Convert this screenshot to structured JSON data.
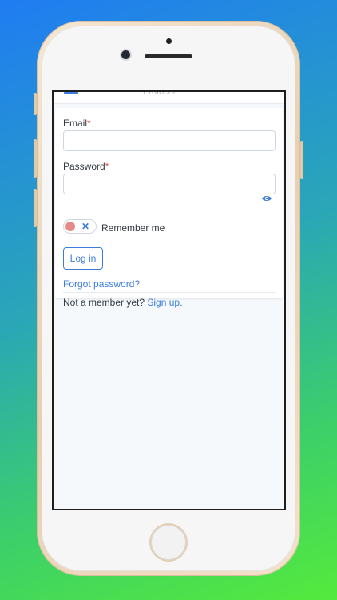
{
  "header": {
    "title": "Protocol"
  },
  "form": {
    "email_label": "Email",
    "password_label": "Password",
    "required_mark": "*",
    "remember_label": "Remember me",
    "toggle_off_glyph": "✕",
    "login_label": "Log in",
    "forgot_label": "Forgot password?",
    "not_member_label": "Not a member yet?",
    "signup_label": "Sign up."
  },
  "colors": {
    "accent": "#3b7ddd",
    "required": "#d9534f",
    "toggle_knob": "#e58a8a"
  },
  "icons": {
    "menu": "hamburger-icon",
    "password_visibility": "eye-icon"
  }
}
